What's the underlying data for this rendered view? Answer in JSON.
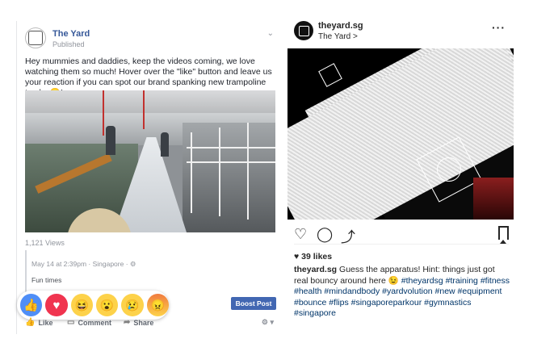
{
  "facebook": {
    "page_name": "The Yard",
    "status": "Published",
    "post_text": "Hey mummies and daddies, keep the videos coming, we love watching them so much! Hover over the \"like\" button and leave us your reaction if you can spot our brand spanking new trampoline tracks 🙂!",
    "views": "1,121 Views",
    "meta": "May 14 at 2:39pm · Singapore · ⚙",
    "caption": "Fun times",
    "reactions": [
      "like",
      "love",
      "haha",
      "wow",
      "sad",
      "angry"
    ],
    "boost_label": "Boost Post",
    "actions": {
      "like": "Like",
      "comment": "Comment",
      "share": "Share"
    },
    "colors": {
      "link": "#365899",
      "boost": "#4267b2"
    }
  },
  "instagram": {
    "username": "theyard.sg",
    "location": "The Yard >",
    "likes": "39 likes",
    "caption_user": "theyard.sg",
    "caption_text": " Guess the apparatus! Hint: things just got real bouncy around here 😉 ",
    "hashtags": "#theyardsg #training #fitness #health #mindandbody #yardvolution #new #equipment #bounce #flips #singaporeparkour #gymnastics #singapore"
  }
}
